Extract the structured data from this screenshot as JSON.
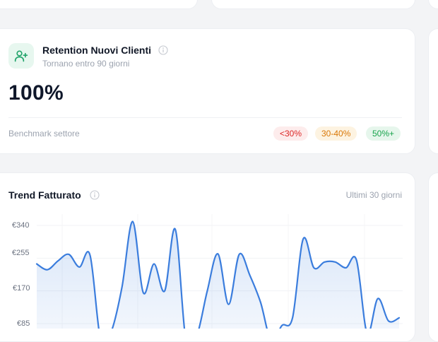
{
  "retention": {
    "title": "Retention Nuovi Clienti",
    "subtitle": "Tornano entro 90 giorni",
    "value": "100%",
    "benchmark_label": "Benchmark settore",
    "badges": [
      {
        "label": "<30%",
        "color": "#dc2626",
        "bg": "#fdecec"
      },
      {
        "label": "30-40%",
        "color": "#d97706",
        "bg": "#fdf3e1"
      },
      {
        "label": "50%+",
        "color": "#16a34a",
        "bg": "#e6f6ec"
      }
    ]
  },
  "trend": {
    "title": "Trend Fatturato",
    "range_label": "Ultimi 30 giorni"
  },
  "chart_data": {
    "type": "area",
    "color": "#3b7ddd",
    "y_ticks": [
      "€340",
      "€255",
      "€170",
      "€85"
    ],
    "y_tick_values": [
      340,
      255,
      170,
      85
    ],
    "ylim": [
      85,
      340
    ],
    "values": [
      240,
      225,
      248,
      265,
      232,
      263,
      42,
      65,
      180,
      350,
      165,
      240,
      170,
      330,
      40,
      52,
      170,
      266,
      135,
      265,
      210,
      140,
      40,
      80,
      100,
      305,
      230,
      245,
      245,
      230,
      250,
      60,
      150,
      92,
      100
    ]
  }
}
